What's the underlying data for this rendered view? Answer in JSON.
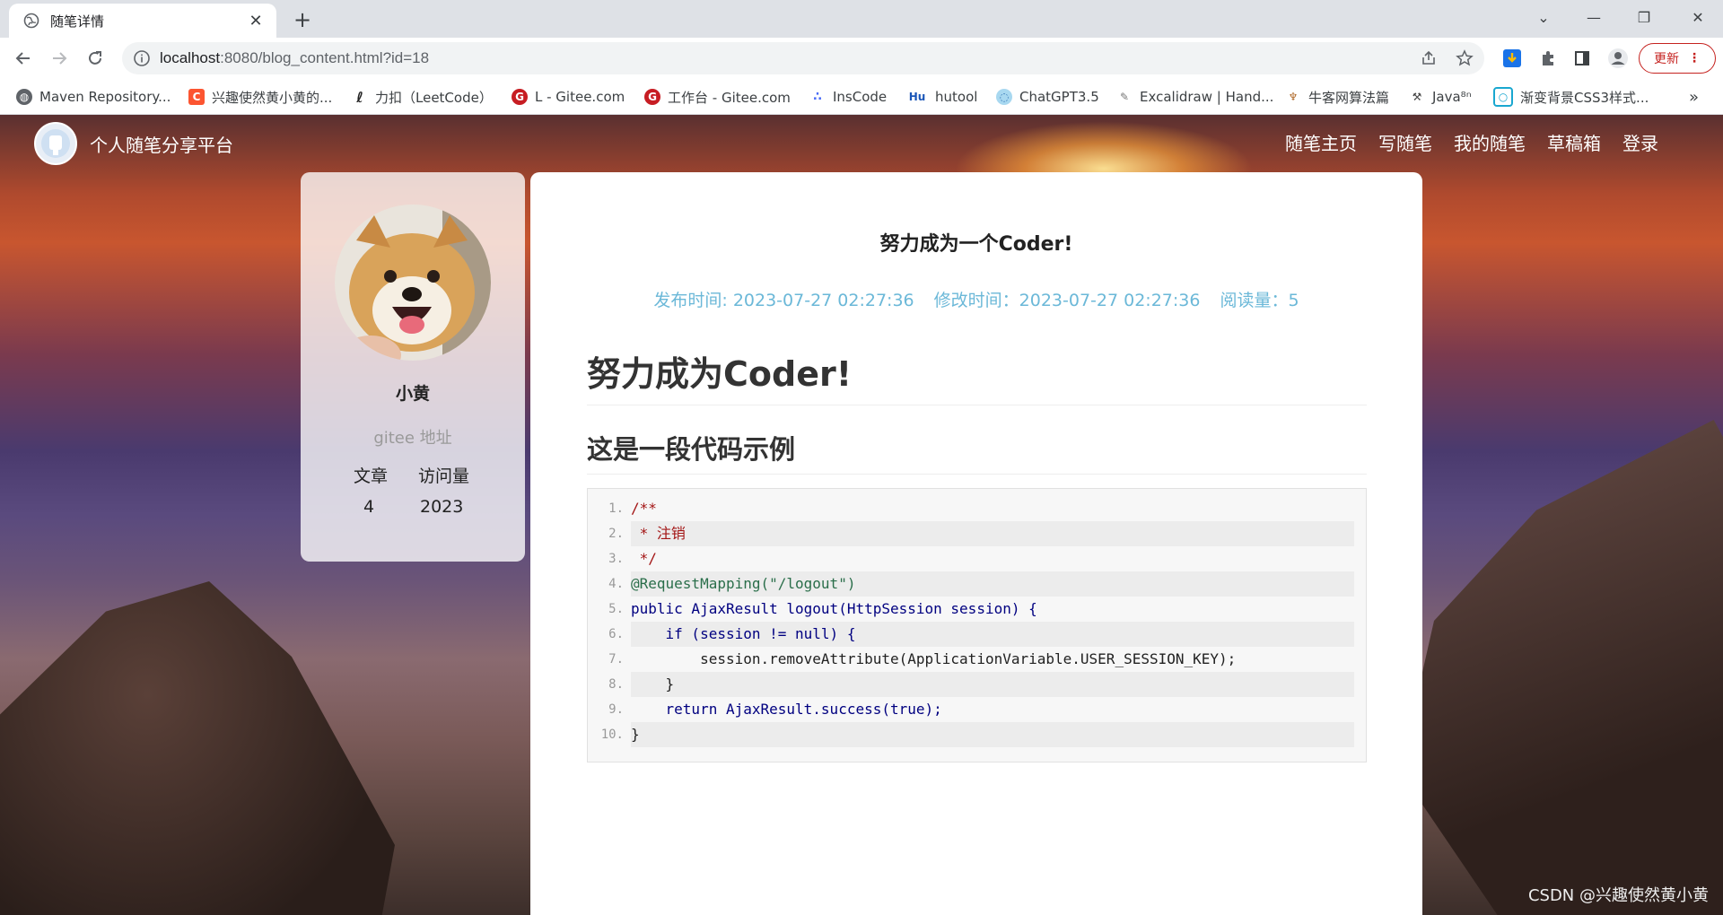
{
  "browser": {
    "tab_title": "随笔详情",
    "url_host": "localhost",
    "url_path": ":8080/blog_content.html?id=18",
    "update_label": "更新",
    "bookmarks": [
      "Maven Repository...",
      "兴趣使然黄小黄的...",
      "力扣（LeetCode）",
      "L - Gitee.com",
      "工作台 - Gitee.com",
      "InsCode",
      "hutool",
      "ChatGPT3.5",
      "Excalidraw | Hand...",
      "牛客网算法篇",
      "Java⁸ⁿ",
      "渐变背景CSS3样式..."
    ],
    "bookmark_more": "»"
  },
  "site": {
    "title": "个人随笔分享平台",
    "nav": [
      "随笔主页",
      "写随笔",
      "我的随笔",
      "草稿箱",
      "登录"
    ]
  },
  "profile": {
    "name": "小黄",
    "gitee": "gitee 地址",
    "articles_label": "文章",
    "visits_label": "访问量",
    "articles": "4",
    "visits": "2023"
  },
  "article": {
    "title": "努力成为一个Coder!",
    "meta": {
      "published": "发布时间: 2023-07-27 02:27:36",
      "modified": "修改时间：2023-07-27 02:27:36",
      "reads": "阅读量：5"
    },
    "h1": "努力成为Coder!",
    "h2": "这是一段代码示例",
    "code_lines": [
      "/**",
      " * 注销",
      " */",
      "@RequestMapping(\"/logout\")",
      "public AjaxResult logout(HttpSession session) {",
      "    if (session != null) {",
      "        session.removeAttribute(ApplicationVariable.USER_SESSION_KEY);",
      "    }",
      "    return AjaxResult.success(true);",
      "}"
    ],
    "line_numbers": [
      "1.",
      "2.",
      "3.",
      "4.",
      "5.",
      "6.",
      "7.",
      "8.",
      "9.",
      "10."
    ]
  },
  "watermark": "CSDN @兴趣使然黄小黄",
  "colors": {
    "meta_blue": "#6bb8d8",
    "update_red": "#c5221f"
  }
}
